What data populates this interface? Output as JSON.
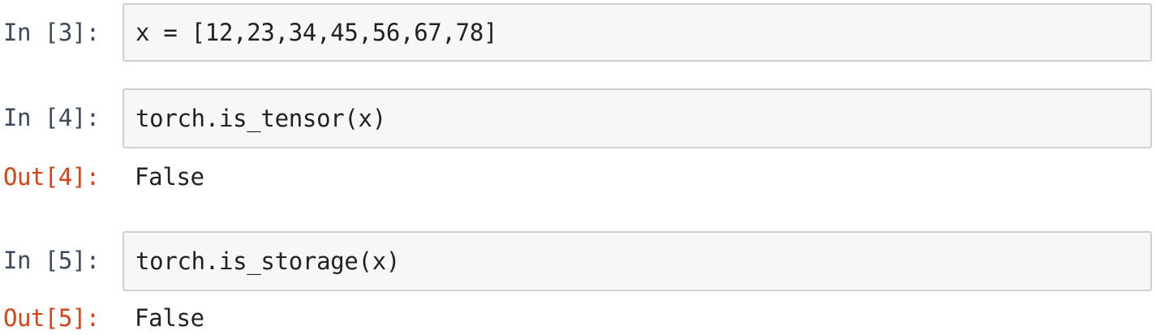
{
  "cells": [
    {
      "in_prompt": "In [3]:",
      "code": "x = [12,23,34,45,56,67,78]"
    },
    {
      "in_prompt": "In [4]:",
      "code": "torch.is_tensor(x)",
      "out_prompt": "Out[4]:",
      "output": "False"
    },
    {
      "in_prompt": "In [5]:",
      "code": "torch.is_storage(x)",
      "out_prompt": "Out[5]:",
      "output": "False"
    }
  ],
  "colors": {
    "in_prompt": "#3d4a5c",
    "out_prompt": "#d84315",
    "input_background": "#f7f7f7",
    "input_border": "#cfcfcf"
  }
}
